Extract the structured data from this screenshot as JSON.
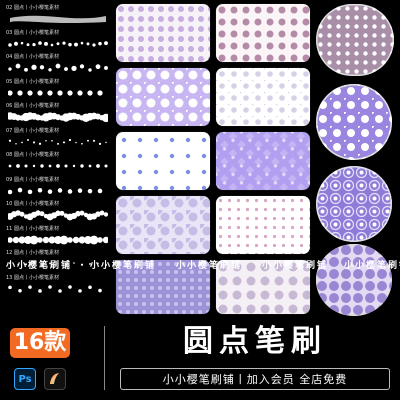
{
  "brush_list": {
    "items": [
      {
        "label": "02 圆点丨小小樱笔素材"
      },
      {
        "label": "03 圆点丨小小樱笔素材"
      },
      {
        "label": "04 圆点丨小小樱笔素材"
      },
      {
        "label": "05 圆点丨小小樱笔素材"
      },
      {
        "label": "06 圆点丨小小樱笔素材"
      },
      {
        "label": "07 圆点丨小小樱笔素材"
      },
      {
        "label": "08 圆点丨小小樱笔素材"
      },
      {
        "label": "09 圆点丨小小樱笔素材"
      },
      {
        "label": "10 圆点丨小小樱笔素材"
      },
      {
        "label": "11 圆点丨小小樱笔素材"
      },
      {
        "label": "12 圆点丨小小樱笔素材"
      },
      {
        "label": "13 圆点丨小小樱笔素材"
      }
    ]
  },
  "watermark": {
    "text": "小小樱笔刷铺"
  },
  "footer": {
    "count": "16款",
    "ps_icon": "Ps",
    "title": "圆点笔刷",
    "subtitle": "小小樱笔刷铺丨加入会员 全店免费"
  },
  "colors": {
    "accent_orange": "#f36b22",
    "lilac": "#c9b8f2",
    "mauve": "#a98ea8",
    "purple_deep": "#8e7bd8",
    "pink_dot": "#d7a7c4",
    "blue_dot": "#7e8fdd"
  },
  "icons": [
    "photoshop-icon",
    "procreate-icon"
  ]
}
